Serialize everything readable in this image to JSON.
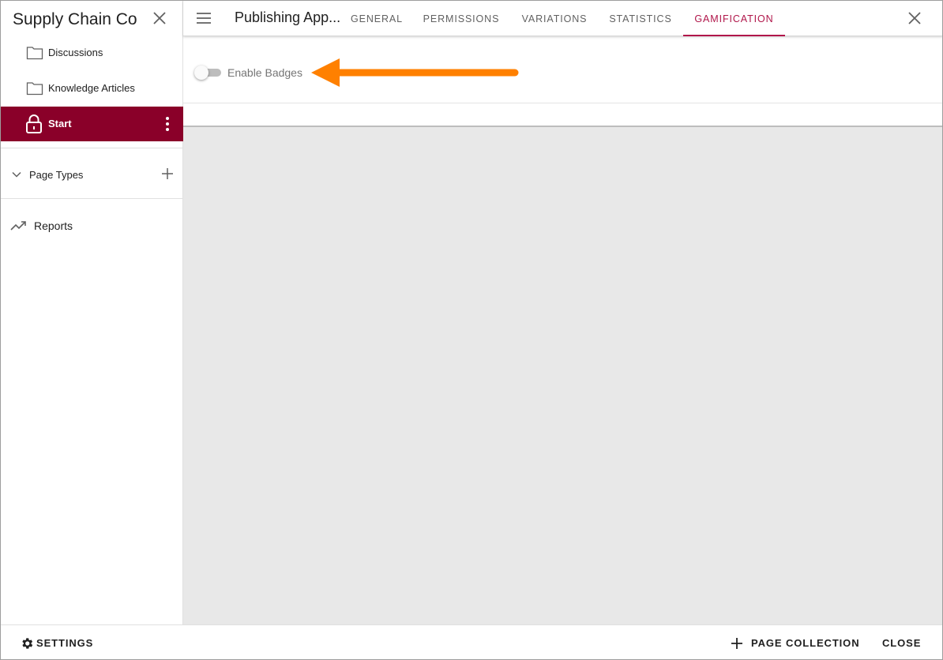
{
  "sidebar": {
    "title": "Supply Chain Co",
    "items": [
      {
        "label": "Discussions",
        "icon": "folder-icon"
      },
      {
        "label": "Knowledge Articles",
        "icon": "folder-icon"
      },
      {
        "label": "Start",
        "icon": "lock-icon",
        "active": true
      }
    ],
    "page_types_label": "Page Types",
    "reports_label": "Reports"
  },
  "header": {
    "title": "Publishing App...",
    "tabs": [
      {
        "label": "GENERAL"
      },
      {
        "label": "PERMISSIONS"
      },
      {
        "label": "VARIATIONS"
      },
      {
        "label": "STATISTICS"
      },
      {
        "label": "GAMIFICATION",
        "active": true
      }
    ]
  },
  "gamification": {
    "enable_badges_label": "Enable Badges",
    "enable_badges_on": false
  },
  "footer": {
    "settings_label": "SETTINGS",
    "page_collection_label": "PAGE COLLECTION",
    "close_label": "CLOSE"
  },
  "colors": {
    "accent": "#b0164a",
    "active_item_bg": "#8a0029",
    "annotation_arrow": "#ff8000",
    "content_bg": "#e8e8e8"
  }
}
